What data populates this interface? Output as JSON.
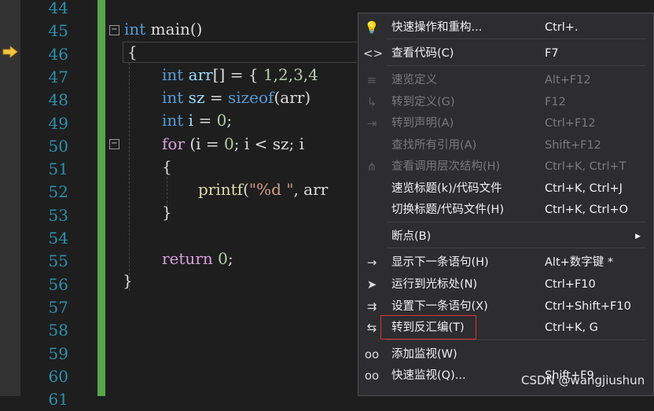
{
  "line_numbers": [
    "44",
    "45",
    "46",
    "47",
    "48",
    "49",
    "50",
    "51",
    "52",
    "53",
    "54",
    "55",
    "56",
    "57",
    "58",
    "59",
    "60",
    "61"
  ],
  "code": {
    "l45": {
      "kw": "int",
      "rest": " main()"
    },
    "l46": "{",
    "l47": {
      "kw": "int",
      "id": " arr",
      "rest": "[] = { ",
      "nums": "1,2,3,4"
    },
    "l48": {
      "kw": "int",
      "id": " sz",
      "op": " = ",
      "kw2": "sizeof",
      "rest": "(arr)"
    },
    "l49": {
      "kw": "int",
      "id": " i",
      "rest": " = ",
      "num": "0",
      "end": ";"
    },
    "l50": {
      "kw": "for",
      "rest": " (i = ",
      "num": "0",
      "rest2": "; i < sz; i"
    },
    "l51": "{",
    "l52": {
      "fn": "printf",
      "p1": "(",
      "str": "\"%d \"",
      "rest": ", arr"
    },
    "l53": "}",
    "l55": {
      "kw": "return",
      "rest": " ",
      "num": "0",
      "end": ";"
    },
    "l56": "}"
  },
  "menu": {
    "items": [
      {
        "icon": "lightbulb-icon",
        "glyph": "💡",
        "label": "快速操作和重构...",
        "shortcut": "Ctrl+.",
        "disabled": false
      },
      {
        "icon": "code-brackets-icon",
        "glyph": "<>",
        "label": "查看代码(C)",
        "shortcut": "F7",
        "disabled": false
      },
      {
        "icon": "peek-definition-icon",
        "glyph": "≡",
        "label": "速览定义",
        "shortcut": "Alt+F12",
        "disabled": true
      },
      {
        "icon": "go-to-definition-icon",
        "glyph": "↳",
        "label": "转到定义(G)",
        "shortcut": "F12",
        "disabled": true
      },
      {
        "icon": "go-to-declaration-icon",
        "glyph": "⇥",
        "label": "转到声明(A)",
        "shortcut": "Ctrl+F12",
        "disabled": true
      },
      {
        "icon": "",
        "glyph": "",
        "label": "查找所有引用(A)",
        "shortcut": "Shift+F12",
        "disabled": true
      },
      {
        "icon": "call-hierarchy-icon",
        "glyph": "⋔",
        "label": "查看调用层次结构(H)",
        "shortcut": "Ctrl+K, Ctrl+T",
        "disabled": true
      },
      {
        "icon": "",
        "glyph": "",
        "label": "速览标题(k)/代码文件",
        "shortcut": "Ctrl+K, Ctrl+J",
        "disabled": false
      },
      {
        "icon": "",
        "glyph": "",
        "label": "切换标题/代码文件(H)",
        "shortcut": "Ctrl+K, Ctrl+O",
        "disabled": false
      },
      {
        "icon": "",
        "glyph": "",
        "label": "断点(B)",
        "shortcut": "",
        "disabled": false,
        "submenu": true
      },
      {
        "icon": "show-next-statement-icon",
        "glyph": "→",
        "label": "显示下一条语句(H)",
        "shortcut": "Alt+数字键 *",
        "disabled": false
      },
      {
        "icon": "run-to-cursor-icon",
        "glyph": "➤",
        "label": "运行到光标处(N)",
        "shortcut": "Ctrl+F10",
        "disabled": false
      },
      {
        "icon": "set-next-statement-icon",
        "glyph": "⇉",
        "label": "设置下一条语句(X)",
        "shortcut": "Ctrl+Shift+F10",
        "disabled": false
      },
      {
        "icon": "go-to-disassembly-icon",
        "glyph": "⇆",
        "label": "转到反汇编(T)",
        "shortcut": "Ctrl+K, G",
        "disabled": false,
        "highlighted": true
      },
      {
        "icon": "add-watch-icon",
        "glyph": "oo",
        "label": "添加监视(W)",
        "shortcut": "",
        "disabled": false
      },
      {
        "icon": "quick-watch-icon",
        "glyph": "oo",
        "label": "快速监视(Q)...",
        "shortcut": "Shift+F9",
        "disabled": false
      }
    ]
  },
  "watermark": "CSDN @wangjiushun",
  "colors": {
    "accent_green": "#57a64a",
    "highlight_box": "#d9363e",
    "arrow_yellow": "#f4c542"
  }
}
